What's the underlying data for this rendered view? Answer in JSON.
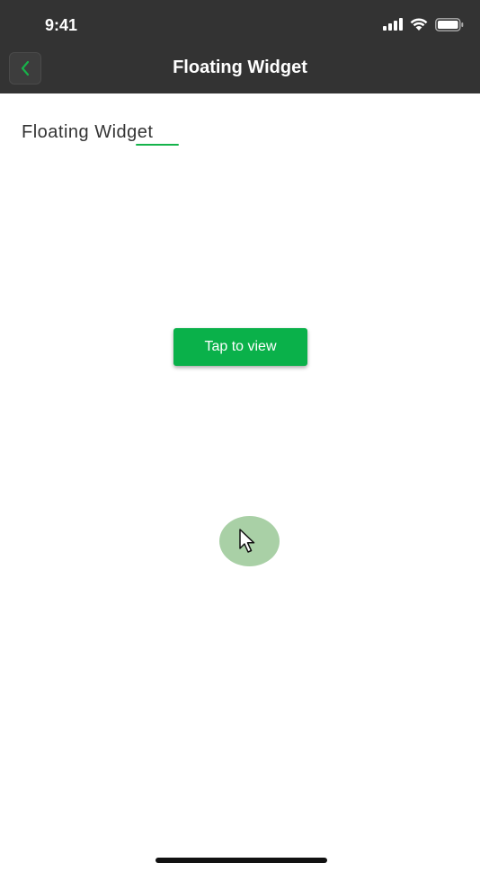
{
  "status_bar": {
    "time": "9:41",
    "icons": [
      "cellular-signal-icon",
      "wifi-icon",
      "battery-icon"
    ]
  },
  "nav": {
    "title": "Floating Widget",
    "back_icon": "chevron-left-icon"
  },
  "content": {
    "heading": "Floating Widget",
    "button_label": "Tap to view",
    "floating_widget_icon": "cursor-arrow-icon"
  },
  "colors": {
    "nav_background": "#333333",
    "accent_green": "#0ab14a",
    "widget_green": "#a9d0a6"
  }
}
